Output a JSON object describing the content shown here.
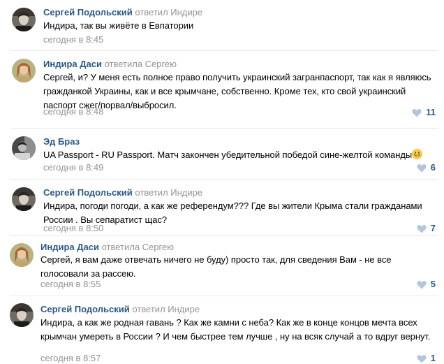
{
  "comments": [
    {
      "author": "Сергей Подольский",
      "reply_to": "ответил Индире",
      "text": "Индира, так вы живёте в Евпатории",
      "date": "сегодня в 8:45",
      "likes": ""
    },
    {
      "author": "Индира Даси",
      "reply_to": "ответила Сергею",
      "text": "Сергей, и? У меня есть полное право получить украинский загранпаспорт, так как я являюсь гражданкой Украины, как и все крымчане, собственно. Кроме тех, кто свой украинский паспорт сжег/порвал/выбросил.",
      "date": "сегодня в 8:48",
      "likes": "11"
    },
    {
      "author": "Эд Браз",
      "reply_to": "",
      "text": "UA Passport - RU Passport. Матч закончен убедительной победой сине-желтой команды",
      "date": "сегодня в 8:49",
      "likes": "6"
    },
    {
      "author": "Сергей Подольский",
      "reply_to": "ответил Индире",
      "text": "Индира, погоди погоди, а как же референдум??? Где вы жители Крыма стали гражданами России . Вы сепаратист щас?",
      "date": "сегодня в 8:50",
      "likes": "7"
    },
    {
      "author": "Индира Даси",
      "reply_to": "ответила Сергею",
      "text": "Сергей, я вам даже отвечать ничего не буду) просто так, для сведения Вам - не все голосовали за рассею.",
      "date": "сегодня в 8:55",
      "likes": "5"
    },
    {
      "author": "Сергей Подольский",
      "reply_to": "ответил Индире",
      "text": "Индира, а как же родная гавань ? Как же камни с неба? Как же в конце концов мечта всех крымчан умереть в России ? И чем быстрее тем лучше , ну на всяк случай а то вдруг вернут.",
      "date": "сегодня в 8:57",
      "likes": "1"
    }
  ],
  "icons": {
    "like": "heart-icon",
    "emoji": "grinning-emoji-icon"
  },
  "colors": {
    "author": "#2a5885",
    "meta": "#939393",
    "heart": "#b4c6db"
  }
}
